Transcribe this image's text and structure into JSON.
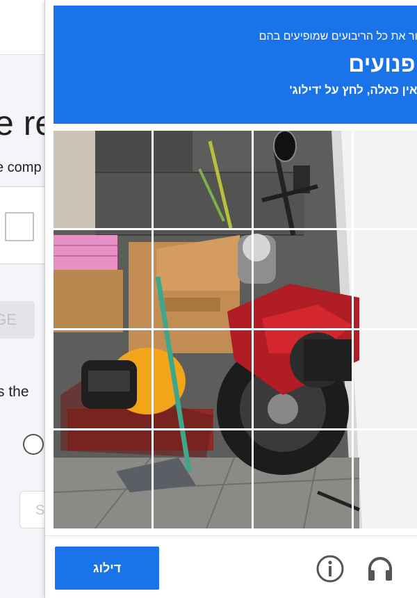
{
  "background_page": {
    "heading_fragment": "e re",
    "subtitle_fragment": "e comp",
    "button_fragment": "GE",
    "question_fragment": "s the",
    "submit_fragment": "S"
  },
  "captcha": {
    "instruction_line1": "לבחור את כל הריבועים שמופיעים בהם",
    "target_word": "אופנועים",
    "instruction_line3": "אם אין כאלה, לחץ על 'דילוג'",
    "skip_label": "דילוג",
    "icons": {
      "info": "info-icon",
      "audio": "headphones-icon"
    },
    "accent_color": "#1a73e8",
    "tiles": [
      {
        "row": 1,
        "col": 1,
        "desc": "wall"
      },
      {
        "row": 1,
        "col": 2,
        "desc": "wall with sticks"
      },
      {
        "row": 1,
        "col": 3,
        "desc": "mirror"
      },
      {
        "row": 1,
        "col": 4,
        "desc": "edge"
      },
      {
        "row": 2,
        "col": 1,
        "desc": "pink basket"
      },
      {
        "row": 2,
        "col": 2,
        "desc": "cardboard box"
      },
      {
        "row": 2,
        "col": 3,
        "desc": "motorcycle"
      },
      {
        "row": 2,
        "col": 4,
        "desc": "motorcycle"
      },
      {
        "row": 3,
        "col": 1,
        "desc": "helmet"
      },
      {
        "row": 3,
        "col": 2,
        "desc": "box and stick"
      },
      {
        "row": 3,
        "col": 3,
        "desc": "motorcycle wheel"
      },
      {
        "row": 3,
        "col": 4,
        "desc": "motorcycle"
      },
      {
        "row": 4,
        "col": 1,
        "desc": "floor"
      },
      {
        "row": 4,
        "col": 2,
        "desc": "dustpan"
      },
      {
        "row": 4,
        "col": 3,
        "desc": "floor"
      },
      {
        "row": 4,
        "col": 4,
        "desc": "edge"
      }
    ]
  }
}
